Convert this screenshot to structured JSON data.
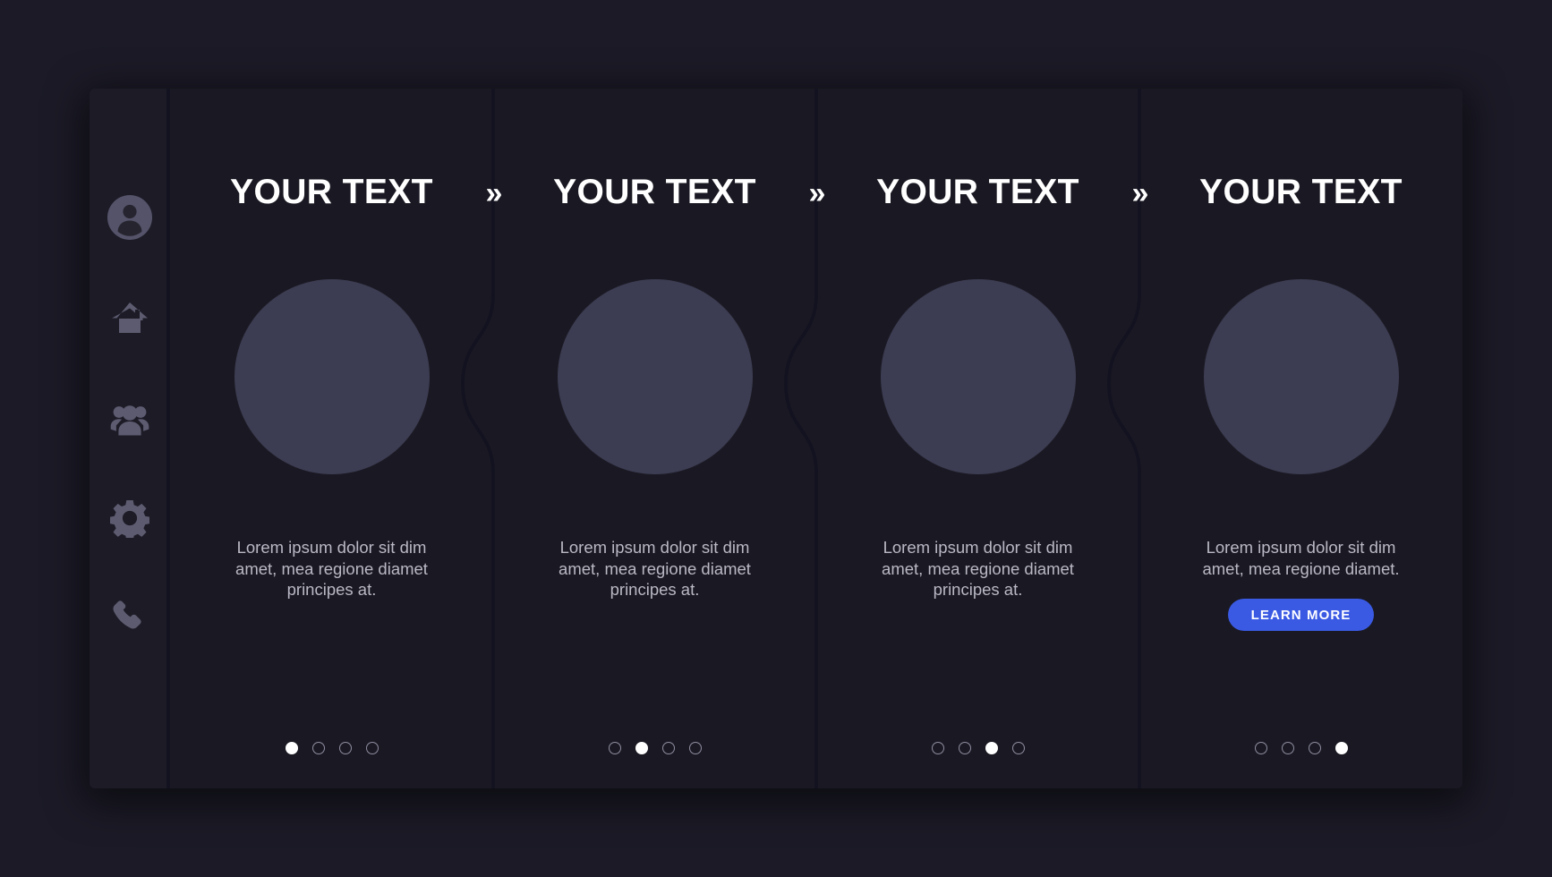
{
  "theme": {
    "page_background": "#1b1a26",
    "panel_background": "#1a1923",
    "sidebar_background": "#1c1b26",
    "divider_color": "#131220",
    "circle_placeholder_color": "#3c3c52",
    "heading_color": "#ffffff",
    "body_text_color": "#b9b8c4",
    "accent_button_color": "#3a5ae4",
    "icon_color": "#5d5b70",
    "dot_inactive_border": "#8f8da0",
    "dot_active_color": "#ffffff"
  },
  "sidebar": {
    "items": [
      {
        "icon": "user-avatar-icon",
        "name": "sidebar-item-profile"
      },
      {
        "icon": "home-icon",
        "name": "sidebar-item-home"
      },
      {
        "icon": "people-group-icon",
        "name": "sidebar-item-team"
      },
      {
        "icon": "gear-icon",
        "name": "sidebar-item-settings"
      },
      {
        "icon": "phone-icon",
        "name": "sidebar-item-contact"
      }
    ]
  },
  "separators": [
    {
      "icon": "double-chevron-right-icon",
      "label": "»"
    },
    {
      "icon": "double-chevron-right-icon",
      "label": "»"
    },
    {
      "icon": "double-chevron-right-icon",
      "label": "»"
    }
  ],
  "cards": [
    {
      "title": "YOUR TEXT",
      "body": "Lorem ipsum dolor sit dim amet, mea regione diamet principes at.",
      "cta": null,
      "dots": {
        "count": 4,
        "active_index": 0
      }
    },
    {
      "title": "YOUR TEXT",
      "body": "Lorem ipsum dolor sit dim amet, mea regione diamet principes at.",
      "cta": null,
      "dots": {
        "count": 4,
        "active_index": 1
      }
    },
    {
      "title": "YOUR TEXT",
      "body": "Lorem ipsum dolor sit dim amet, mea regione diamet principes at.",
      "cta": null,
      "dots": {
        "count": 4,
        "active_index": 2
      }
    },
    {
      "title": "YOUR TEXT",
      "body": "Lorem ipsum dolor sit dim amet, mea regione diamet.",
      "cta": "LEARN MORE",
      "dots": {
        "count": 4,
        "active_index": 3
      }
    }
  ]
}
